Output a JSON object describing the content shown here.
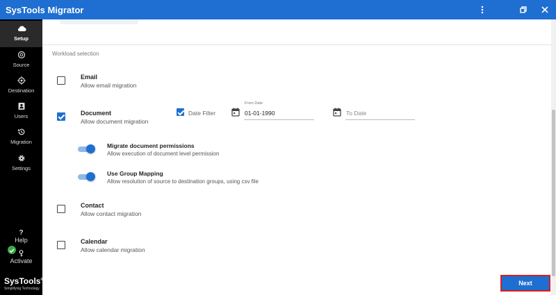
{
  "window": {
    "title": "SysTools Migrator",
    "accent_color": "#1e6fd1",
    "controls": [
      "more-vert-icon",
      "restore-icon",
      "close-icon"
    ]
  },
  "sidebar": {
    "items": [
      {
        "label": "Setup",
        "icon": "cloud-icon",
        "active": true
      },
      {
        "label": "Source",
        "icon": "source-icon",
        "active": false
      },
      {
        "label": "Destination",
        "icon": "target-icon",
        "active": false
      },
      {
        "label": "Users",
        "icon": "user-card-icon",
        "active": false
      },
      {
        "label": "Migration",
        "icon": "history-icon",
        "active": false
      },
      {
        "label": "Settings",
        "icon": "gear-icon",
        "active": false
      }
    ],
    "help_label": "Help",
    "activate_label": "Activate",
    "brand": {
      "name": "SysTools",
      "tagline": "Simplifying Technology"
    }
  },
  "main": {
    "section_label": "Workload selection",
    "workloads": [
      {
        "title": "Email",
        "desc": "Allow email migration",
        "checked": false
      },
      {
        "title": "Document",
        "desc": "Allow document migration",
        "checked": true
      },
      {
        "title": "Contact",
        "desc": "Allow contact migration",
        "checked": false
      },
      {
        "title": "Calendar",
        "desc": "Allow calendar migration",
        "checked": false
      }
    ],
    "date_filter": {
      "label": "Date Filter",
      "checked": true,
      "from_label": "From Date",
      "from_value": "01-01-1990",
      "to_placeholder": "To Date"
    },
    "document_options": [
      {
        "title": "Migrate document permissions",
        "desc": "Allow execution of document level permission",
        "enabled": true
      },
      {
        "title": "Use Group Mapping",
        "desc": "Allow resolution of source to destination groups, using csv file",
        "enabled": true
      }
    ]
  },
  "footer": {
    "next_label": "Next"
  }
}
